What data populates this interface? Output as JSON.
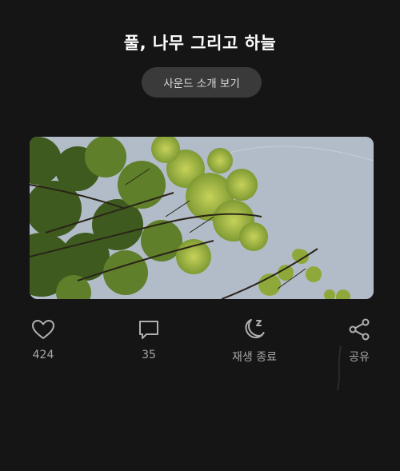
{
  "post": {
    "title": "풀, 나무 그리고 하늘",
    "sound_button_label": "사운드 소개 보기"
  },
  "actions": {
    "like": {
      "icon": "heart-icon",
      "count": "424"
    },
    "comment": {
      "icon": "comment-icon",
      "count": "35"
    },
    "sleep": {
      "icon": "moon-sleep-icon",
      "label": "재생 종료"
    },
    "share": {
      "icon": "share-icon",
      "label": "공유"
    }
  },
  "colors": {
    "background": "#151515",
    "button_bg": "#3a3a3a",
    "icon": "#b0b0b0",
    "label": "#a8a8a8"
  }
}
